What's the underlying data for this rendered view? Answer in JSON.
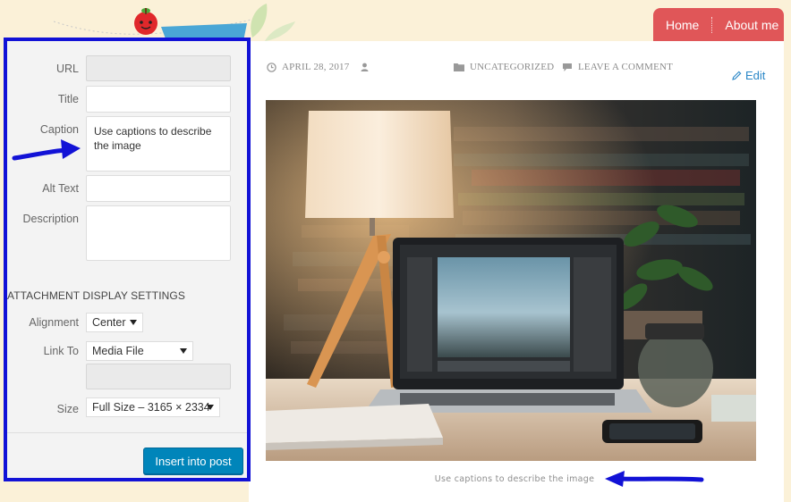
{
  "nav": {
    "items": [
      "Home",
      "About me"
    ]
  },
  "post_meta": {
    "date": "APRIL 28, 2017",
    "category": "UNCATEGORIZED",
    "comment": "LEAVE A COMMENT",
    "edit": "Edit"
  },
  "image_caption": "Use captions to describe the image",
  "attachment": {
    "url_label": "URL",
    "url_value": "",
    "title_label": "Title",
    "title_value": "",
    "caption_label": "Caption",
    "caption_value": "Use captions to describe the image",
    "alt_label": "Alt Text",
    "alt_value": "",
    "description_label": "Description",
    "description_value": ""
  },
  "display_settings": {
    "heading": "ATTACHMENT DISPLAY SETTINGS",
    "alignment_label": "Alignment",
    "alignment_value": "Center",
    "link_label": "Link To",
    "link_value": "Media File",
    "link_url": "",
    "size_label": "Size",
    "size_value": "Full Size – 3165 × 2334"
  },
  "insert_button": "Insert into post",
  "colors": {
    "accent": "#0085ba",
    "nav": "#e05658",
    "panel_border": "#1212d6",
    "arrow": "#1212d6"
  }
}
